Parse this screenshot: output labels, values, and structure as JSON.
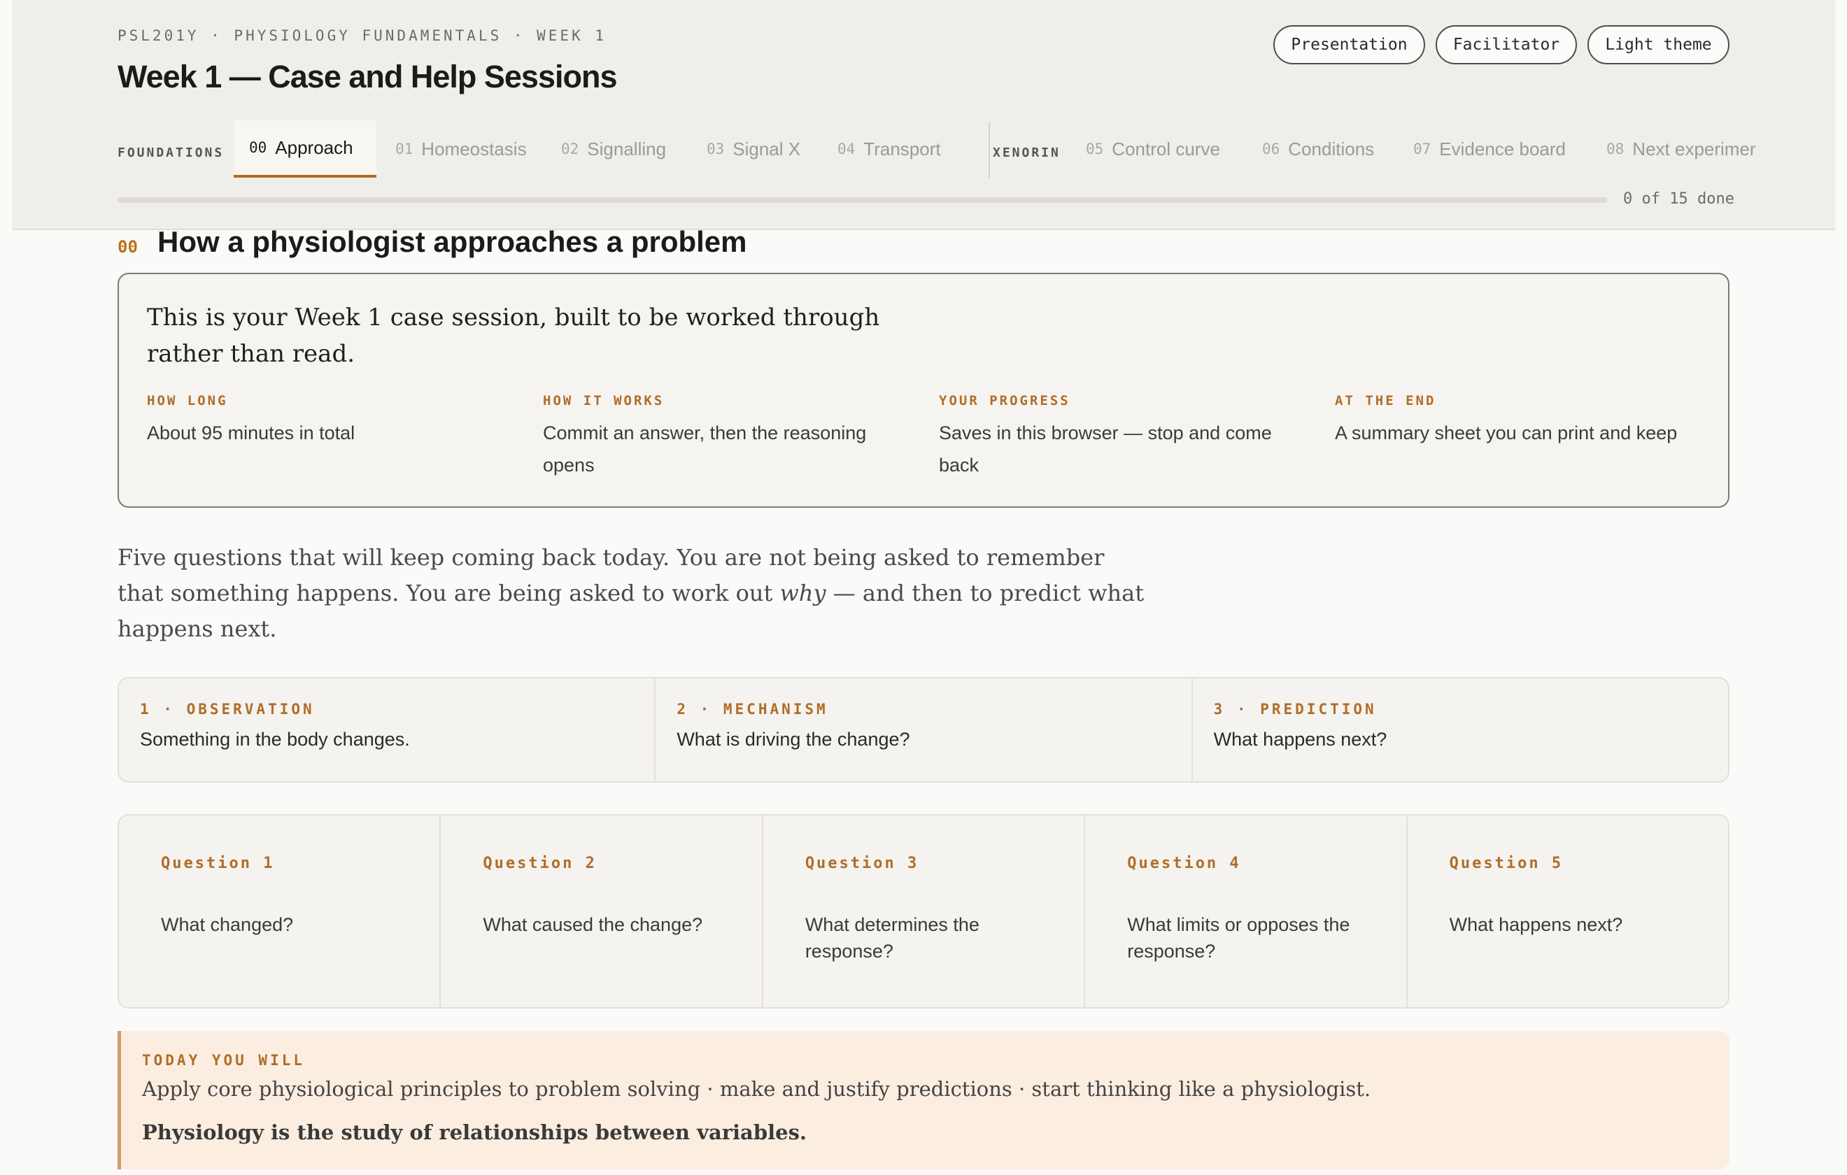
{
  "header": {
    "eyebrow": "PSL201Y · PHYSIOLOGY FUNDAMENTALS · WEEK 1",
    "title": "Week 1 — Case and Help Sessions",
    "buttons": {
      "presentation": "Presentation",
      "facilitator": "Facilitator",
      "theme": "Light theme"
    }
  },
  "nav": {
    "groups": [
      "FOUNDATIONS",
      "XENORIN"
    ],
    "tabs": [
      {
        "num": "00",
        "label": "Approach",
        "active": true
      },
      {
        "num": "01",
        "label": "Homeostasis"
      },
      {
        "num": "02",
        "label": "Signalling"
      },
      {
        "num": "03",
        "label": "Signal X"
      },
      {
        "num": "04",
        "label": "Transport"
      },
      {
        "num": "05",
        "label": "Control curve"
      },
      {
        "num": "06",
        "label": "Conditions"
      },
      {
        "num": "07",
        "label": "Evidence board"
      },
      {
        "num": "08",
        "label": "Next experimer"
      }
    ],
    "progress_text": "0 of 15 done",
    "progress_fraction": 0
  },
  "section": {
    "num": "00",
    "title": "How a physiologist approaches a problem",
    "lead": "This is your Week 1 case session, built to be worked through rather than read.",
    "facts": [
      {
        "label": "HOW LONG",
        "value": "About 95 minutes in total"
      },
      {
        "label": "HOW IT WORKS",
        "value": "Commit an answer, then the reasoning opens"
      },
      {
        "label": "YOUR PROGRESS",
        "value": "Saves in this browser — stop and come back"
      },
      {
        "label": "AT THE END",
        "value": "A summary sheet you can print and keep"
      }
    ],
    "para_before": "Five questions that will keep coming back today. You are not being asked to remember that something happens. You are being asked to work out ",
    "para_em": "why",
    "para_after": " — and then to predict what happens next.",
    "steps": [
      {
        "label": "1 · OBSERVATION",
        "text": "Something in the body changes."
      },
      {
        "label": "2 · MECHANISM",
        "text": "What is driving the change?"
      },
      {
        "label": "3 · PREDICTION",
        "text": "What happens next?"
      }
    ],
    "questions": [
      {
        "label": "Question 1",
        "text": "What changed?"
      },
      {
        "label": "Question 2",
        "text": "What caused the change?"
      },
      {
        "label": "Question 3",
        "text": "What determines the response?"
      },
      {
        "label": "Question 4",
        "text": "What limits or opposes the response?"
      },
      {
        "label": "Question 5",
        "text": "What happens next?"
      }
    ],
    "today": {
      "label": "TODAY YOU WILL",
      "text": "Apply core physiological principles to problem solving · make and justify predictions · start thinking like a physiologist.",
      "bold": "Physiology is the study of relationships between variables."
    }
  },
  "colors": {
    "accent": "#b06d28",
    "header_bg": "#efeee9",
    "today_bg": "#fbede0"
  }
}
